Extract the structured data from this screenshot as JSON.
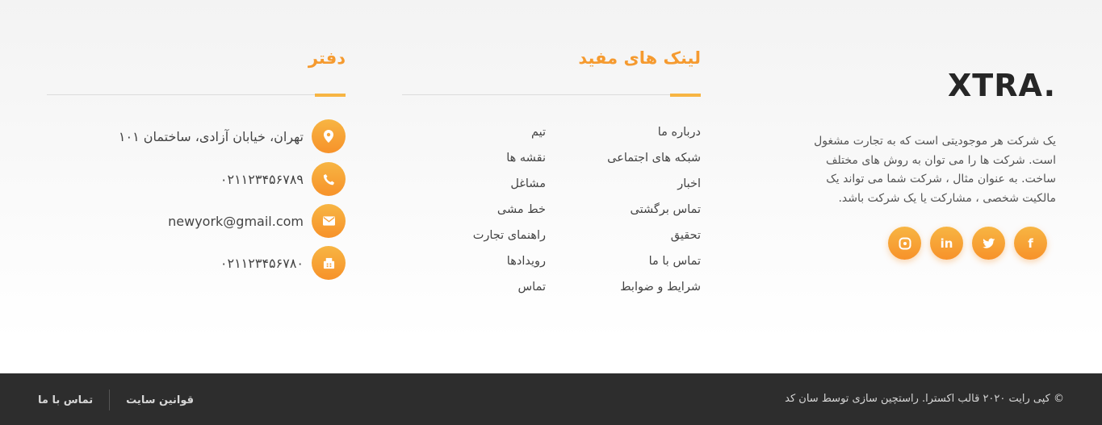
{
  "brand": {
    "logo": "XTRA.",
    "about_lines": [
      "یک شرکت هر موجودیتی است که به تجارت مشغول",
      "است. شرکت ها را می توان به روش های مختلف",
      "ساخت. به عنوان مثال ، شرکت شما می تواند یک",
      "مالکیت شخصی ، مشارکت یا یک شرکت باشد."
    ],
    "socials": [
      {
        "name": "facebook-icon",
        "glyph": "f"
      },
      {
        "name": "twitter-icon",
        "glyph": "t"
      },
      {
        "name": "linkedin-icon",
        "glyph": "in"
      },
      {
        "name": "dribbble-icon",
        "glyph": "◍"
      }
    ]
  },
  "links": {
    "title": "لینک های مفید",
    "col1": [
      "درباره ما",
      "شبکه های اجتماعی",
      "اخبار",
      "تماس برگشتی",
      "تحقیق",
      "تماس با ما",
      "شرایط و ضوابط"
    ],
    "col2": [
      "تیم",
      "نقشه ها",
      "مشاغل",
      "خط مشی",
      "راهنمای تجارت",
      "رویدادها",
      "تماس"
    ]
  },
  "office": {
    "title": "دفتر",
    "address": "تهران، خیابان آزادی، ساختمان ۱۰۱",
    "phone": "۰۲۱۱۲۳۴۵۶۷۸۹",
    "email": "newyork@gmail.com",
    "fax": "۰۲۱۱۲۳۴۵۶۷۸۰"
  },
  "bottom": {
    "copyright": "© کپی رایت ۲۰۲۰ قالب اکسترا. راستچین سازی توسط سان کد",
    "terms": "قوانین سایت",
    "contact": "تماس با ما"
  },
  "colors": {
    "accent": "#f59a2f",
    "accent_light": "#f7b543",
    "bottom_bg": "#2d2d2d"
  }
}
